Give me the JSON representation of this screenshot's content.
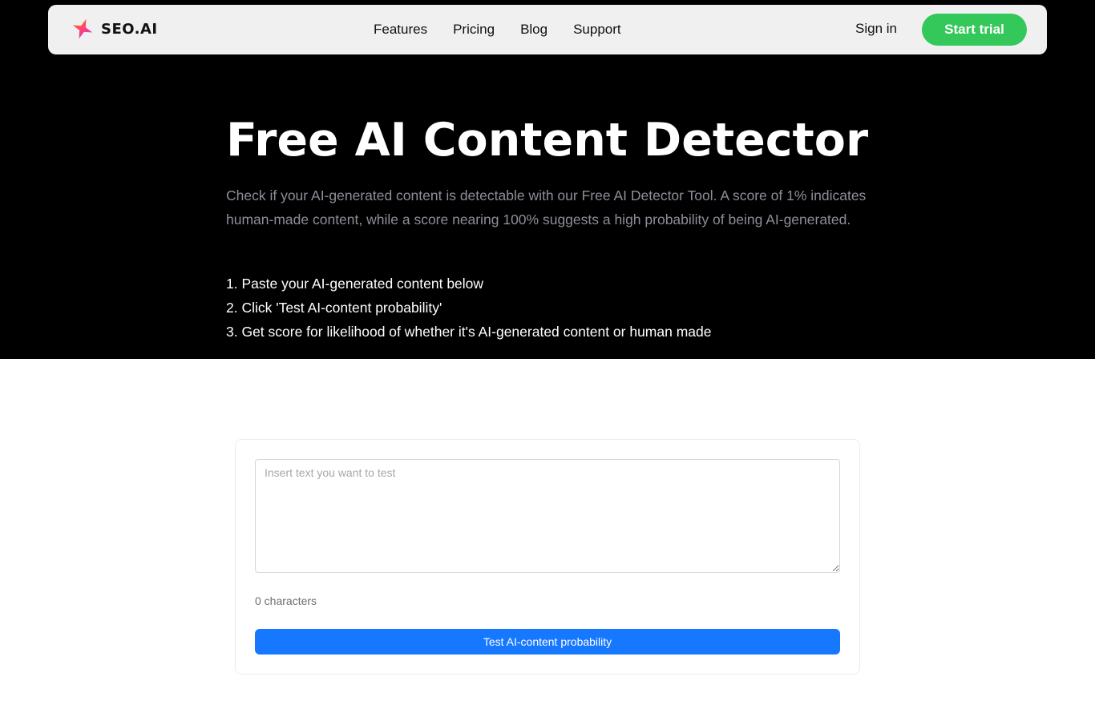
{
  "brand": {
    "name": "SEO.AI",
    "logo_icon": "seo-ai-star-logo",
    "logo_colors": [
      "#ff3d7f",
      "#ff7a00",
      "#a24bff"
    ]
  },
  "nav": {
    "links": [
      "Features",
      "Pricing",
      "Blog",
      "Support"
    ],
    "sign_in": "Sign in",
    "start_trial": "Start trial"
  },
  "hero": {
    "title": "Free AI Content Detector",
    "description": "Check if your AI-generated content is detectable with our Free AI Detector Tool. A score of 1% indicates human-made content, while a score nearing 100% suggests a high probability of being AI-generated.",
    "steps": [
      "1. Paste your AI-generated content below",
      "2. Click 'Test AI-content probability'",
      "3. Get score for likelihood of whether it's AI-generated content or human made"
    ]
  },
  "detector": {
    "input_value": "",
    "input_placeholder": "Insert text you want to test",
    "char_count": "0 characters",
    "button_label": "Test AI-content probability"
  },
  "colors": {
    "hero_bg": "#000000",
    "trial_button": "#34c759",
    "test_button": "#1677ff"
  }
}
